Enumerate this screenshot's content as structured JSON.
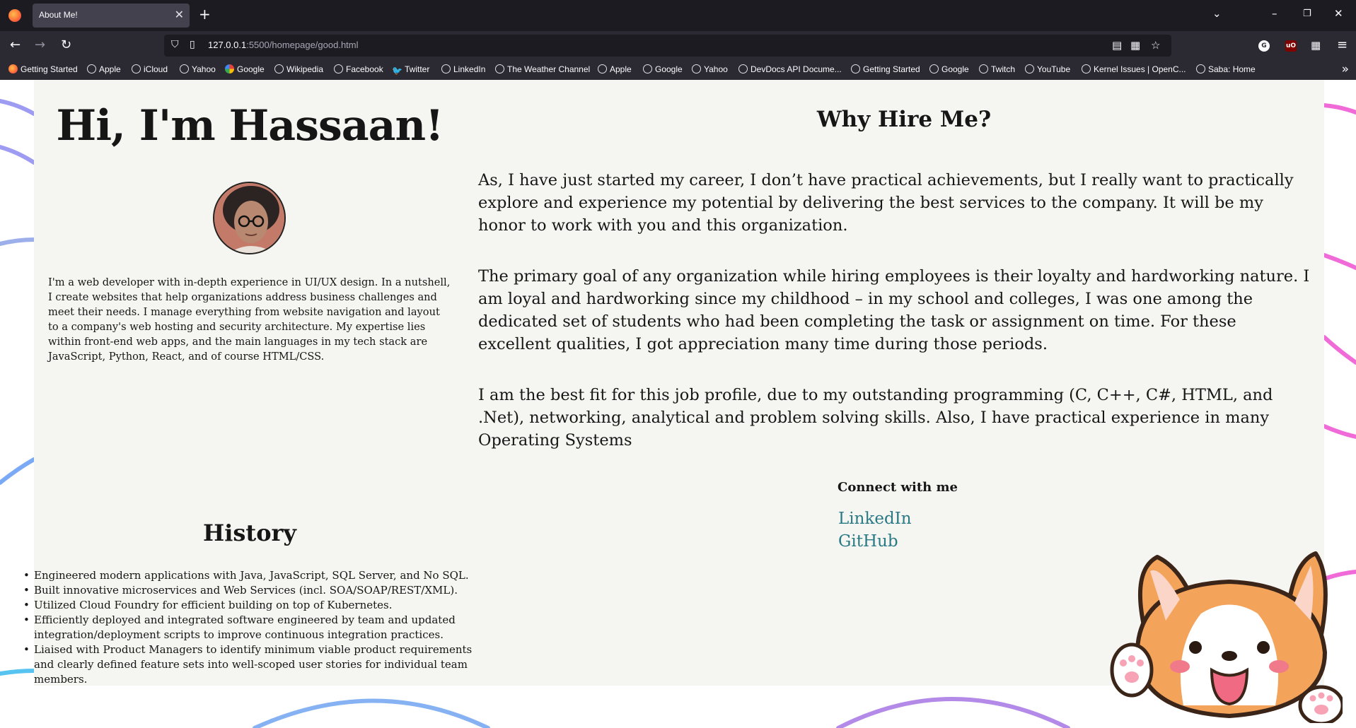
{
  "browser": {
    "tab_title": "About Me!",
    "url_host": "127.0.0.1",
    "url_rest": ":5500/homepage/good.html",
    "bookmarks": [
      {
        "label": "Getting Started",
        "icon": "firefox-icon"
      },
      {
        "label": "Apple",
        "icon": "globe-icon"
      },
      {
        "label": "iCloud",
        "icon": "globe-icon"
      },
      {
        "label": "Yahoo",
        "icon": "globe-icon"
      },
      {
        "label": "Google",
        "icon": "google-icon"
      },
      {
        "label": "Wikipedia",
        "icon": "globe-icon"
      },
      {
        "label": "Facebook",
        "icon": "globe-icon"
      },
      {
        "label": "Twitter",
        "icon": "twitter-icon"
      },
      {
        "label": "LinkedIn",
        "icon": "globe-icon"
      },
      {
        "label": "The Weather Channel",
        "icon": "globe-icon"
      },
      {
        "label": "Apple",
        "icon": "globe-icon"
      },
      {
        "label": "Google",
        "icon": "globe-icon"
      },
      {
        "label": "Yahoo",
        "icon": "globe-icon"
      },
      {
        "label": "DevDocs API Docume...",
        "icon": "globe-icon"
      },
      {
        "label": "Getting Started",
        "icon": "globe-icon"
      },
      {
        "label": "Google",
        "icon": "globe-icon"
      },
      {
        "label": "Twitch",
        "icon": "globe-icon"
      },
      {
        "label": "YouTube",
        "icon": "globe-icon"
      },
      {
        "label": "Kernel Issues | OpenC...",
        "icon": "globe-icon"
      },
      {
        "label": "Saba: Home",
        "icon": "globe-icon"
      }
    ]
  },
  "page": {
    "heading": "Hi, I'm Hassaan!",
    "about": "I'm a web developer with in-depth experience in UI/UX design. In a nutshell, I create websites that help organizations address business challenges and meet their needs. I manage everything from website navigation and layout to a company's web hosting and security architecture. My expertise lies within front-end web apps, and the main languages in my tech stack are JavaScript, Python, React, and of course HTML/CSS.",
    "why_title": "Why Hire Me?",
    "why_paragraphs": [
      "As, I have just started my career, I don’t have practical achievements, but I really want to practically explore and experience my potential by delivering the best services to the company. It will be my honor to work with you and this organization.",
      "The primary goal of any organization while hiring employees is their loyalty and hardworking nature. I am loyal and hardworking since my childhood – in my school and colleges, I was one among the dedicated set of students who had been completing the task or assignment on time. For these excellent qualities, I got appreciation many time during those periods.",
      "I am the best fit for this job profile, due to my outstanding programming (C, C++, C#, HTML, and .Net), networking, analytical and problem solving skills. Also, I have practical experience in many Operating Systems"
    ],
    "connect_title": "Connect with me",
    "links": [
      "LinkedIn",
      "GitHub"
    ],
    "history_title": "History",
    "history": [
      "Engineered modern applications with Java, JavaScript, SQL Server, and No SQL.",
      "Built innovative microservices and Web Services (incl. SOA/SOAP/REST/XML).",
      "Utilized Cloud Foundry for efficient building on top of Kubernetes.",
      "Efficiently deployed and integrated software engineered by team and updated integration/deployment scripts to improve continuous integration practices.",
      "Liaised with Product Managers to identify minimum viable product requirements and clearly defined feature sets into well-scoped user stories for individual team members."
    ],
    "colors": {
      "content_bg": "#f5f5f1",
      "link": "#2a7a86",
      "deco_pink": "#f06ad8",
      "deco_blue": "#7aaaf5",
      "deco_purple": "#b48ae8"
    }
  }
}
